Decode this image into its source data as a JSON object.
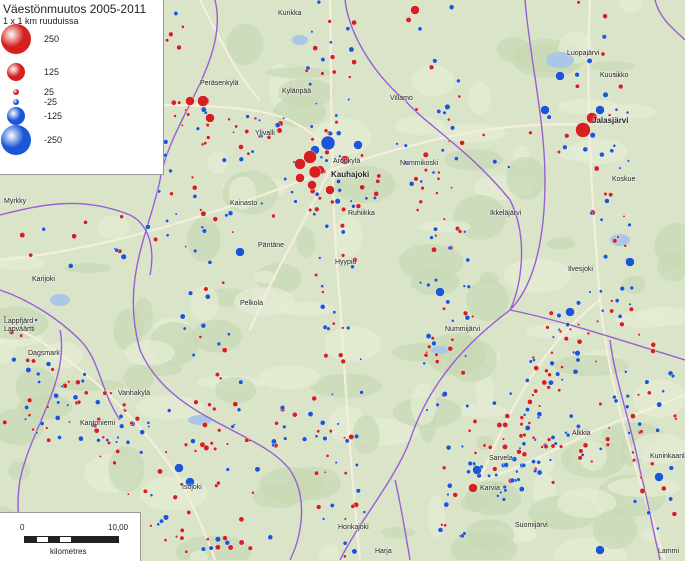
{
  "legend": {
    "title": "Väestönmuutos 2005-2011",
    "subtitle": "1 x 1 km ruuduissa",
    "classes": [
      {
        "label": "250",
        "color": "#d42020"
      },
      {
        "label": "125",
        "color": "#d42020"
      },
      {
        "label": "25",
        "color": "#d42020"
      },
      {
        "label": "-25",
        "color": "#1a56d6"
      },
      {
        "label": "-125",
        "color": "#1a56d6"
      },
      {
        "label": "-250",
        "color": "#1a56d6"
      }
    ]
  },
  "scalebar": {
    "start": "0",
    "end": "10,00",
    "unit": "kilometres"
  },
  "places": [
    {
      "name": "Kauhajoki",
      "big": true
    },
    {
      "name": "Aronkylä"
    },
    {
      "name": "Jalasjärvi",
      "big": true
    },
    {
      "name": "Ilvesjoki"
    },
    {
      "name": "Päntäne"
    },
    {
      "name": "Hyypiö"
    },
    {
      "name": "Ruhiikka"
    },
    {
      "name": "Karijoki"
    },
    {
      "name": "Myrkky"
    },
    {
      "name": "Isojoki"
    },
    {
      "name": "Karvia"
    },
    {
      "name": "Sarvela"
    },
    {
      "name": "Alkkia"
    },
    {
      "name": "Kurikka"
    },
    {
      "name": "Koskue"
    },
    {
      "name": "Luopajärvi"
    },
    {
      "name": "Kuninkaanl."
    },
    {
      "name": "Lammi"
    },
    {
      "name": "Suomijärvi"
    },
    {
      "name": "Honkajoki"
    },
    {
      "name": "Peräsenkylä"
    },
    {
      "name": "Kylänpää"
    },
    {
      "name": "Nummikoski"
    },
    {
      "name": "Ylivalli"
    },
    {
      "name": "Nummijärvi"
    },
    {
      "name": "Vanhakylä"
    },
    {
      "name": "Lappfjärd"
    },
    {
      "name": "Dagsmark"
    },
    {
      "name": "Kantoniemi"
    },
    {
      "name": "Pelkola"
    },
    {
      "name": "Kainasto"
    },
    {
      "name": "Villamo"
    },
    {
      "name": "Lapväärtti"
    },
    {
      "name": "Ikkeläjärvi"
    },
    {
      "name": "Kuusikko"
    },
    {
      "name": "Harja"
    }
  ],
  "colors": {
    "land": "#d9e4c8",
    "boundary": "#9a5fd6",
    "road": "#e8e2c6",
    "increase": "#d42020",
    "decrease": "#1a56d6"
  }
}
